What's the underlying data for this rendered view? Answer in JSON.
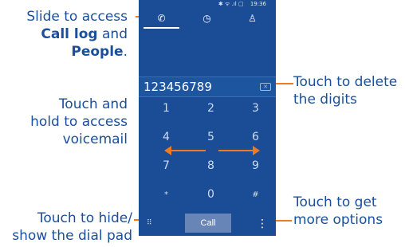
{
  "status_bar": {
    "icons": "✱ ᯤ .ıl ▢",
    "time": "19:36"
  },
  "tabs": [
    {
      "name": "dialer",
      "icon": "phone-icon",
      "glyph": "✆"
    },
    {
      "name": "call-log",
      "icon": "clock-icon",
      "glyph": "◷"
    },
    {
      "name": "people",
      "icon": "person-icon",
      "glyph": "♙"
    }
  ],
  "number_display": {
    "value": "123456789"
  },
  "keypad": [
    "1",
    "2",
    "3",
    "4",
    "5",
    "6",
    "7",
    "8",
    "9",
    "*",
    "0",
    "#"
  ],
  "bottom_bar": {
    "call_label": "Call",
    "menu_glyph": "⋮",
    "dialpad_glyph": "⠿"
  },
  "annotations": {
    "slide": {
      "line1": "Slide to access",
      "bold1": "Call log",
      "mid": " and",
      "bold2": "People",
      "end": "."
    },
    "touch_hold": {
      "line1": "Touch and",
      "line2": "hold to access",
      "line3": "voicemail"
    },
    "hide_show": {
      "line1": "Touch to hide/",
      "line2": "show the dial pad"
    },
    "delete": {
      "line1": "Touch to delete",
      "line2": "the digits"
    },
    "more": {
      "line1": "Touch to get",
      "line2": "more options"
    }
  },
  "colors": {
    "phone_bg": "#1a4d96",
    "annotation_text": "#1a4f9c",
    "pointer": "#f07a20"
  }
}
